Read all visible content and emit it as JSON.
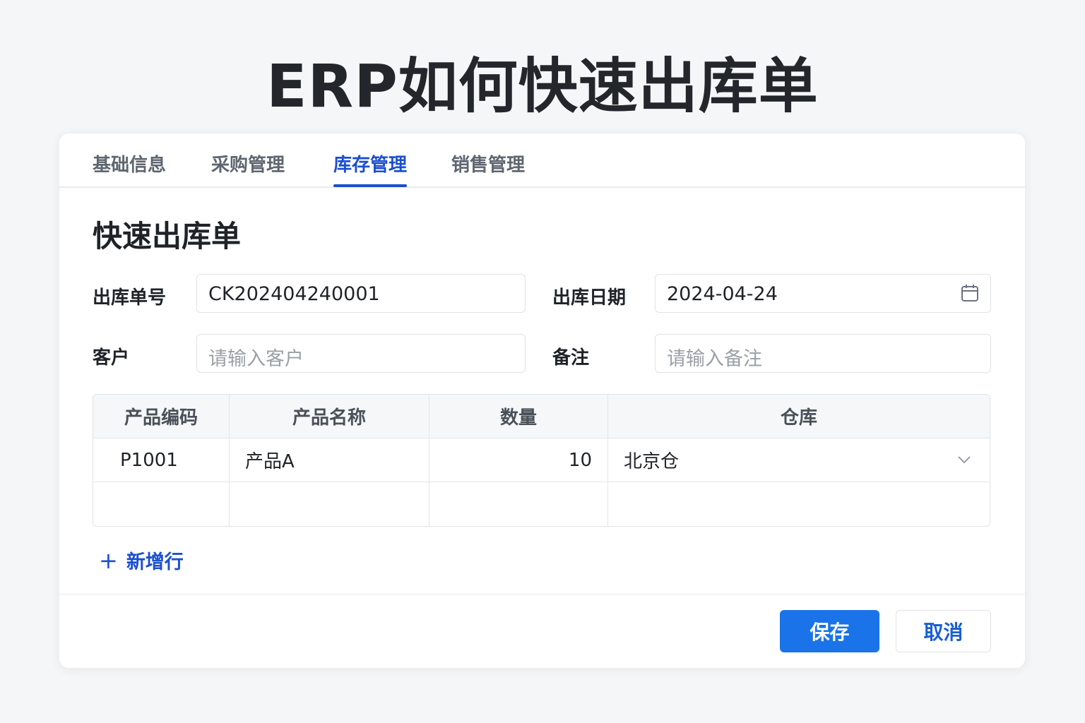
{
  "page_title": "ERP如何快速出库单",
  "tabs": [
    "基础信息",
    "采购管理",
    "库存管理",
    "销售管理"
  ],
  "active_tab": "库存管理",
  "section_title": "快速出库单",
  "form": {
    "order_no_label": "出库单号",
    "order_no_value": "CK202404240001",
    "date_label": "出库日期",
    "date_value": "2024-04-24",
    "customer_label": "客户",
    "customer_placeholder": "请输入客户",
    "remark_label": "备注",
    "remark_placeholder": "请输入备注"
  },
  "table": {
    "headers": [
      "产品编码",
      "产品名称",
      "数量",
      "仓库"
    ],
    "rows": [
      {
        "code": "P1001",
        "name": "产品A",
        "qty": "10",
        "warehouse": "北京仓"
      }
    ]
  },
  "add_row_label": "新增行",
  "buttons": {
    "save": "保存",
    "cancel": "取消"
  },
  "colors": {
    "primary": "#1a73e8",
    "tab_active": "#1a4fd0"
  }
}
